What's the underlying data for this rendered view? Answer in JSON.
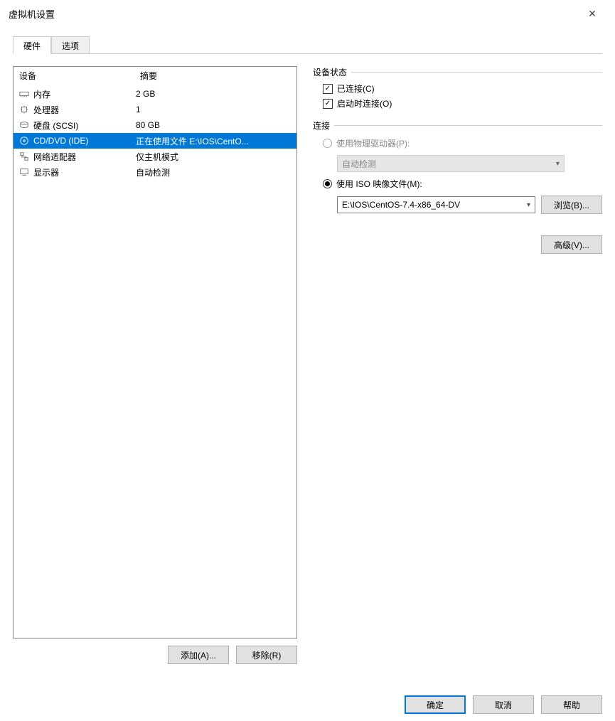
{
  "window": {
    "title": "虚拟机设置"
  },
  "tabs": {
    "hardware": "硬件",
    "options": "选项"
  },
  "columns": {
    "device": "设备",
    "summary": "摘要"
  },
  "devices": [
    {
      "id": "memory",
      "name": "内存",
      "summary": "2 GB"
    },
    {
      "id": "cpu",
      "name": "处理器",
      "summary": "1"
    },
    {
      "id": "hdd",
      "name": "硬盘 (SCSI)",
      "summary": "80 GB"
    },
    {
      "id": "cddvd",
      "name": "CD/DVD (IDE)",
      "summary": "正在使用文件 E:\\IOS\\CentO..."
    },
    {
      "id": "net",
      "name": "网络适配器",
      "summary": "仅主机模式"
    },
    {
      "id": "display",
      "name": "显示器",
      "summary": "自动检测"
    }
  ],
  "leftButtons": {
    "add": "添加(A)...",
    "remove": "移除(R)"
  },
  "status": {
    "group": "设备状态",
    "connected": "已连接(C)",
    "connectAtPowerOn": "启动时连接(O)"
  },
  "connection": {
    "group": "连接",
    "physical": "使用物理驱动器(P):",
    "physicalValue": "自动检测",
    "iso": "使用 ISO 映像文件(M):",
    "isoValue": "E:\\IOS\\CentOS-7.4-x86_64-DV",
    "browse": "浏览(B)..."
  },
  "advanced": "高级(V)...",
  "footer": {
    "ok": "确定",
    "cancel": "取消",
    "help": "帮助"
  }
}
